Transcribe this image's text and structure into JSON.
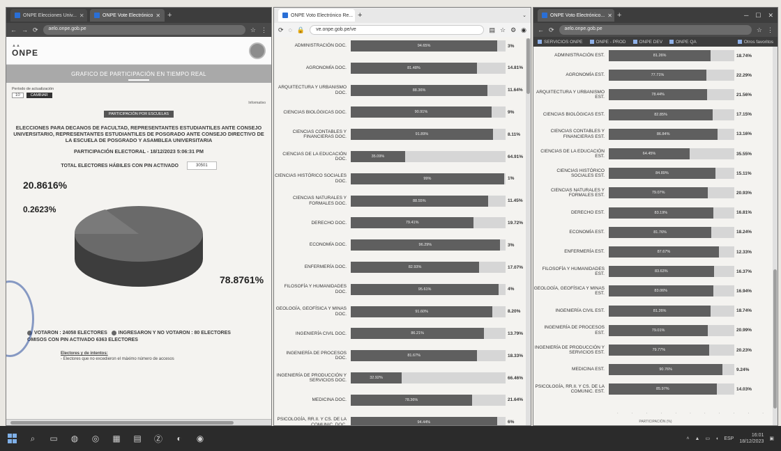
{
  "left_window": {
    "tabs": [
      {
        "label": "ONPE Elecciones Univ...",
        "active": false
      },
      {
        "label": "ONPE Vote Electrónico",
        "active": true
      }
    ],
    "url": "aelo.onpe.gob.pe",
    "logo": "ONPE",
    "title_band": "GRAFICO DE PARTICIPACIÓN EN TIEMPO REAL",
    "refresh_label": "Período de actualización",
    "refresh_value": "10",
    "refresh_button": "CAMBIAR",
    "top_link": "Informativo",
    "pill": "PARTICIPACIÓN POR ESCUELAS",
    "election_title": "ELECCIONES PARA DECANOS DE FACULTAD, REPRESENTANTES ESTUDIANTILES ANTE CONSEJO UNIVERSITARIO, REPRESENTANTES ESTUDIANTILES DE POSGRADO ANTE CONSEJO DIRECTIVO DE LA ESCUELA DE POSGRADO Y ASAMBLEA UNIVERSITARIA",
    "participation_line": "PARTICIPACIÓN ELECTORAL - 18/12/2023 5:06:31 PM",
    "total_label": "TOTAL ELECTORES HÁBILES CON PIN ACTIVADO",
    "total_value": "30501",
    "pie_labels": {
      "left_top": "20.8616%",
      "left_mid": "0.2623%",
      "right": "78.8761%"
    },
    "legend_line1_a": "VOTARON : 24058 ELECTORES",
    "legend_line1_b": "INGRESARON Y NO VOTARON : 80 ELECTORES",
    "legend_line2": "OMISOS CON PIN ACTIVADO   6363 ELECTORES",
    "note_title": "Electores y de intentos:",
    "note_text": "- Electores que no excedieron el máximo número de accesos"
  },
  "mid_window": {
    "tab_label": "ONPE Voto Electrónico Re...",
    "url": "ve.onpe.gob.pe/ve",
    "rows": [
      {
        "label": "ADMINISTRACIÓN DOC.",
        "in_label": "94.65%",
        "out_label": "3%"
      },
      {
        "label": "AGRONOMÍA DOC.",
        "in_label": "81.48%",
        "out_label": "14.81%"
      },
      {
        "label": "ARQUITECTURA Y URBANISMO DOC.",
        "in_label": "88.36%",
        "out_label": "11.64%"
      },
      {
        "label": "CIENCIAS BIOLÓGICAS DOC.",
        "in_label": "90.91%",
        "out_label": "9%"
      },
      {
        "label": "CIENCIAS CONTABLES Y FINANCIERAS DOC.",
        "in_label": "91.89%",
        "out_label": "8.11%"
      },
      {
        "label": "CIENCIAS DE LA EDUCACIÓN DOC.",
        "in_label": "35.09%",
        "out_label": "64.91%"
      },
      {
        "label": "CIENCIAS HISTÓRICO SOCIALES DOC.",
        "in_label": "99%",
        "out_label": "1%"
      },
      {
        "label": "CIENCIAS NATURALES Y FORMALES DOC.",
        "in_label": "88.55%",
        "out_label": "11.45%"
      },
      {
        "label": "DERECHO DOC.",
        "in_label": "79.41%",
        "out_label": "19.72%"
      },
      {
        "label": "ECONOMÍA DOC.",
        "in_label": "96.29%",
        "out_label": "3%"
      },
      {
        "label": "ENFERMERÍA DOC.",
        "in_label": "82.93%",
        "out_label": "17.07%"
      },
      {
        "label": "FILOSOFÍA Y HUMANIDADES DOC.",
        "in_label": "95.61%",
        "out_label": "4%"
      },
      {
        "label": "GEOLOGÍA, GEOFÍSICA Y MINAS DOC.",
        "in_label": "91.60%",
        "out_label": "8.20%"
      },
      {
        "label": "INGENIERÍA CIVIL DOC.",
        "in_label": "86.21%",
        "out_label": "13.79%"
      },
      {
        "label": "INGENIERÍA DE PROCESOS DOC.",
        "in_label": "81.67%",
        "out_label": "18.33%"
      },
      {
        "label": "INGENIERÍA DE PRODUCCIÓN Y SERVICIOS DOC.",
        "in_label": "32.92%",
        "out_label": "66.46%"
      },
      {
        "label": "MEDICINA DOC.",
        "in_label": "78.36%",
        "out_label": "21.64%"
      },
      {
        "label": "PSICOLOGÍA, RR.II. Y CS. DE LA COMUNIC. DOC.",
        "in_label": "94.44%",
        "out_label": "6%"
      }
    ]
  },
  "right_window": {
    "tab_label": "ONPE Voto Electrónico...",
    "url": "aelo.onpe.gob.pe",
    "bookmarks": [
      "SERVICIOS ONPE",
      "ONPE - PROD",
      "ONPE DEV",
      "ONPE QA"
    ],
    "bookmark_right": "Otros favoritos",
    "rows": [
      {
        "label": "ADMINISTRACIÓN EST.",
        "in_label": "81.26%",
        "out_label": "18.74%"
      },
      {
        "label": "AGRONOMÍA EST.",
        "in_label": "77.71%",
        "out_label": "22.29%"
      },
      {
        "label": "ARQUITECTURA Y URBANISMO EST.",
        "in_label": "78.44%",
        "out_label": "21.56%"
      },
      {
        "label": "CIENCIAS BIOLÓGICAS EST.",
        "in_label": "82.85%",
        "out_label": "17.15%"
      },
      {
        "label": "CIENCIAS CONTABLES Y FINANCIERAS EST.",
        "in_label": "86.84%",
        "out_label": "13.16%"
      },
      {
        "label": "CIENCIAS DE LA EDUCACIÓN EST.",
        "in_label": "64.45%",
        "out_label": "35.55%"
      },
      {
        "label": "CIENCIAS HISTÓRICO SOCIALES EST.",
        "in_label": "84.89%",
        "out_label": "15.11%"
      },
      {
        "label": "CIENCIAS NATURALES Y FORMALES EST.",
        "in_label": "79.07%",
        "out_label": "20.93%"
      },
      {
        "label": "DERECHO EST.",
        "in_label": "83.19%",
        "out_label": "16.81%"
      },
      {
        "label": "ECONOMÍA EST.",
        "in_label": "81.76%",
        "out_label": "18.24%"
      },
      {
        "label": "ENFERMERÍA EST.",
        "in_label": "87.67%",
        "out_label": "12.33%"
      },
      {
        "label": "FILOSOFÍA Y HUMANIDADES EST.",
        "in_label": "83.63%",
        "out_label": "16.37%"
      },
      {
        "label": "GEOLOGÍA, GEOFÍSICA Y MINAS EST.",
        "in_label": "83.06%",
        "out_label": "16.94%"
      },
      {
        "label": "INGENIERÍA CIVIL EST.",
        "in_label": "81.26%",
        "out_label": "18.74%"
      },
      {
        "label": "INGENIERÍA DE PROCESOS EST.",
        "in_label": "79.01%",
        "out_label": "20.99%"
      },
      {
        "label": "INGENIERÍA DE PRODUCCIÓN Y SERVICIOS EST.",
        "in_label": "79.77%",
        "out_label": "20.23%"
      },
      {
        "label": "MEDICINA EST.",
        "in_label": "90.76%",
        "out_label": "9.24%"
      },
      {
        "label": "PSICOLOGÍA, RR.II. Y CS. DE LA COMUNIC. EST.",
        "in_label": "85.97%",
        "out_label": "14.03%"
      }
    ],
    "axis_title": "PARTICIPACIÓN (%)"
  },
  "taskbar": {
    "time": "16:01",
    "date": "18/12/2023",
    "lang": "ESP"
  },
  "colors": {
    "bar_fill": "#5f5f5f",
    "bar_rest": "#d6d6d6",
    "pie_main": "#6a6a6a",
    "pie_dark": "#3d3d3d"
  }
}
